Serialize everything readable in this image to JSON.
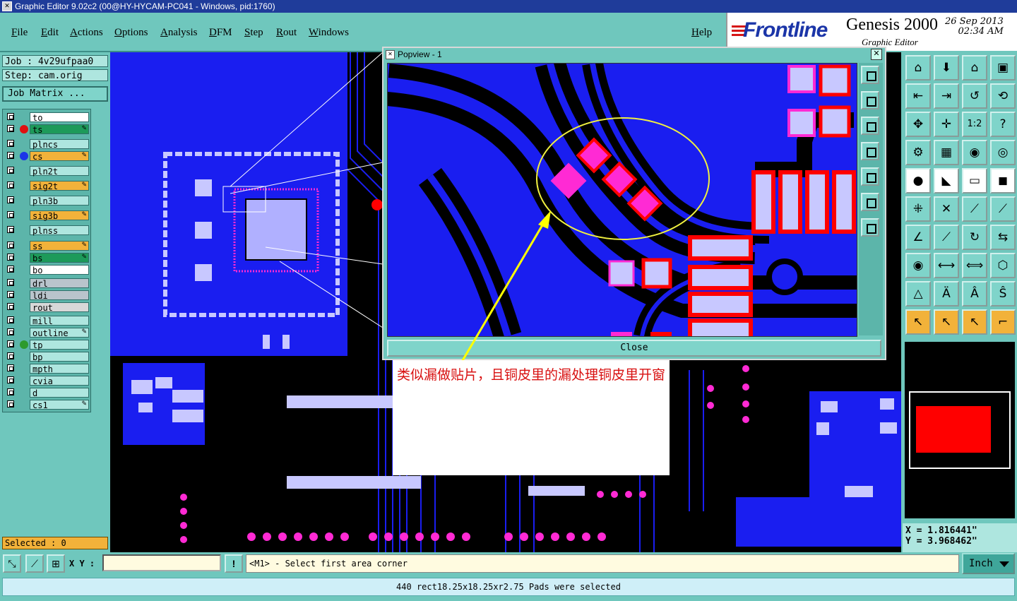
{
  "window": {
    "title": "Graphic Editor 9.02c2 (00@HY-HYCAM-PC041 - Windows, pid:1760)"
  },
  "menu": [
    "File",
    "Edit",
    "Actions",
    "Options",
    "Analysis",
    "DFM",
    "Step",
    "Rout",
    "Windows"
  ],
  "help_label": "Help",
  "brand": {
    "logo": "Frontline",
    "product": "Genesis 2000",
    "date": "26 Sep 2013",
    "time": "02:34 AM",
    "subtitle": "Graphic Editor"
  },
  "job": {
    "job_label": "Job : 4v29ufpaa0",
    "step_label": "Step: cam.orig",
    "matrix_button": "Job Matrix ..."
  },
  "layers": [
    {
      "name": "to",
      "bg": "#ffffff",
      "dot": ""
    },
    {
      "name": "ts",
      "bg": "#1d9a5a",
      "dot": "#e01010",
      "edit": true
    },
    {
      "name": "plncs",
      "bg": "#aee6df",
      "dot": ""
    },
    {
      "name": "cs",
      "bg": "#f2b23a",
      "dot": "#1b35e8",
      "edit": true
    },
    {
      "name": "pln2t",
      "bg": "#aee6df",
      "dot": ""
    },
    {
      "name": "sig2t",
      "bg": "#f2b23a",
      "dot": "",
      "edit": true
    },
    {
      "name": "pln3b",
      "bg": "#aee6df",
      "dot": ""
    },
    {
      "name": "sig3b",
      "bg": "#f2b23a",
      "dot": "",
      "edit": true
    },
    {
      "name": "plnss",
      "bg": "#aee6df",
      "dot": ""
    },
    {
      "name": "ss",
      "bg": "#f2b23a",
      "dot": "",
      "edit": true
    },
    {
      "name": "bs",
      "bg": "#1d9a5a",
      "dot": "",
      "edit": true
    },
    {
      "name": "bo",
      "bg": "#ffffff",
      "dot": ""
    },
    {
      "name": "drl",
      "bg": "#b9c4cc",
      "dot": ""
    },
    {
      "name": "ldi",
      "bg": "#b9c4cc",
      "dot": ""
    },
    {
      "name": "rout",
      "bg": "#d8d8d8",
      "dot": ""
    },
    {
      "name": "mill",
      "bg": "#aee6df",
      "dot": ""
    },
    {
      "name": "outline",
      "bg": "#aee6df",
      "dot": "",
      "edit": true
    },
    {
      "name": "tp",
      "bg": "#aee6df",
      "dot": "#2d9a2d"
    },
    {
      "name": "bp",
      "bg": "#aee6df",
      "dot": ""
    },
    {
      "name": "mpth",
      "bg": "#aee6df",
      "dot": ""
    },
    {
      "name": "cvia",
      "bg": "#aee6df",
      "dot": ""
    },
    {
      "name": "d",
      "bg": "#aee6df",
      "dot": ""
    },
    {
      "name": "cs1",
      "bg": "#aee6df",
      "dot": "",
      "edit": true
    }
  ],
  "selected_label": "Selected : 0",
  "popview": {
    "title": "Popview - 1",
    "close_label": "Close",
    "close_x": "✕"
  },
  "annotation": {
    "text": "类似漏做贴片，且铜皮里的漏处理铜皮里开窗"
  },
  "coords": {
    "x": "X = 1.816441\"",
    "y": "Y = 3.968462\""
  },
  "command": {
    "xy_label": "X Y :",
    "xy_value": "",
    "prompt": "<M1> - Select first area corner",
    "unit": "Inch"
  },
  "message": "440 rect18.25x18.25xr2.75 Pads were selected",
  "colors": {
    "panel": "#6fc7bd",
    "copper": "#1a1ef0",
    "pad": "#ff2ad4",
    "solder": "#ff0000",
    "annotation_text": "#d81010",
    "arrow": "#ffff00"
  }
}
